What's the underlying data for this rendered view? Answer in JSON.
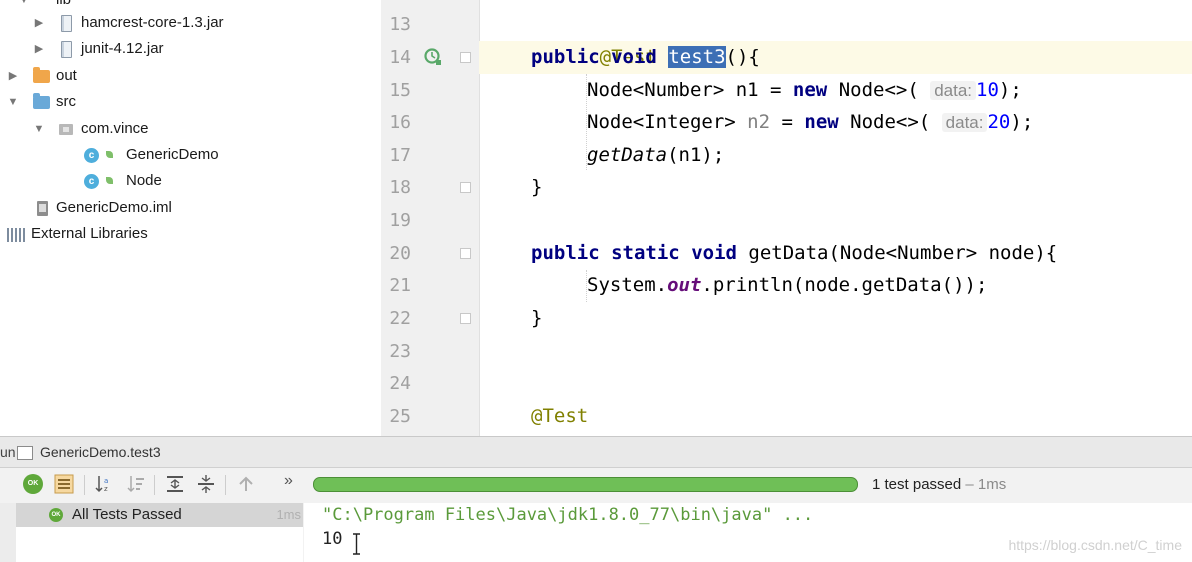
{
  "tree": {
    "items": [
      {
        "label": "lib",
        "kind": "folder-gray",
        "depth": 1
      },
      {
        "label": "hamcrest-core-1.3.jar",
        "kind": "jar",
        "depth": 2
      },
      {
        "label": "junit-4.12.jar",
        "kind": "jar",
        "depth": 2
      },
      {
        "label": "out",
        "kind": "folder-orange",
        "depth": 0
      },
      {
        "label": "src",
        "kind": "folder-blue",
        "depth": 0
      },
      {
        "label": "com.vince",
        "kind": "package",
        "depth": 1
      },
      {
        "label": "GenericDemo",
        "kind": "class",
        "depth": 2
      },
      {
        "label": "Node",
        "kind": "class",
        "depth": 2
      },
      {
        "label": "GenericDemo.iml",
        "kind": "iml",
        "depth": 1
      },
      {
        "label": "External Libraries",
        "kind": "libraries",
        "depth": 0
      }
    ]
  },
  "editor": {
    "line_numbers": [
      "13",
      "14",
      "15",
      "16",
      "17",
      "18",
      "19",
      "20",
      "21",
      "22",
      "23",
      "24",
      "25"
    ],
    "hint_label": "data:",
    "tokens": {
      "test_ann": "@Test",
      "public": "public",
      "void": "void",
      "static": "static",
      "new": "new",
      "method_test3": "test3",
      "open_sig": "(){",
      "node_number": "Node<Number>",
      "node_integer": "Node<Integer>",
      "n1_assign": " n1 = ",
      "n2_var": " n2",
      "assign": " = ",
      "node_diamond": " Node<>(",
      "val10": "10",
      "val20": "20",
      "close_stmt": ");",
      "getdata_call": "getData",
      "getdata_args": "(n1);",
      "close_brace": "}",
      "getdata_sig": " getData(Node<Number> node){",
      "system": "System.",
      "out_field": "out",
      "println_rest": ".println(node.getData());"
    }
  },
  "run": {
    "prefix": "un",
    "tab_title": "GenericDemo.test3",
    "status": "1 test passed",
    "duration": " – 1ms",
    "progress": 1.0,
    "tests": [
      {
        "label": "All Tests Passed",
        "time": "1ms",
        "status": "OK"
      }
    ],
    "console": [
      "\"C:\\Program Files\\Java\\jdk1.8.0_77\\bin\\java\" ...",
      "10"
    ],
    "ok_badge": "OK",
    "expand_label": "»"
  },
  "watermark": "https://blog.csdn.net/C_time",
  "colors": {
    "keyword": "#000080",
    "annotation": "#808000",
    "number": "#0000ff",
    "selection": "#3d6fb5",
    "pass": "#6fbf57"
  }
}
